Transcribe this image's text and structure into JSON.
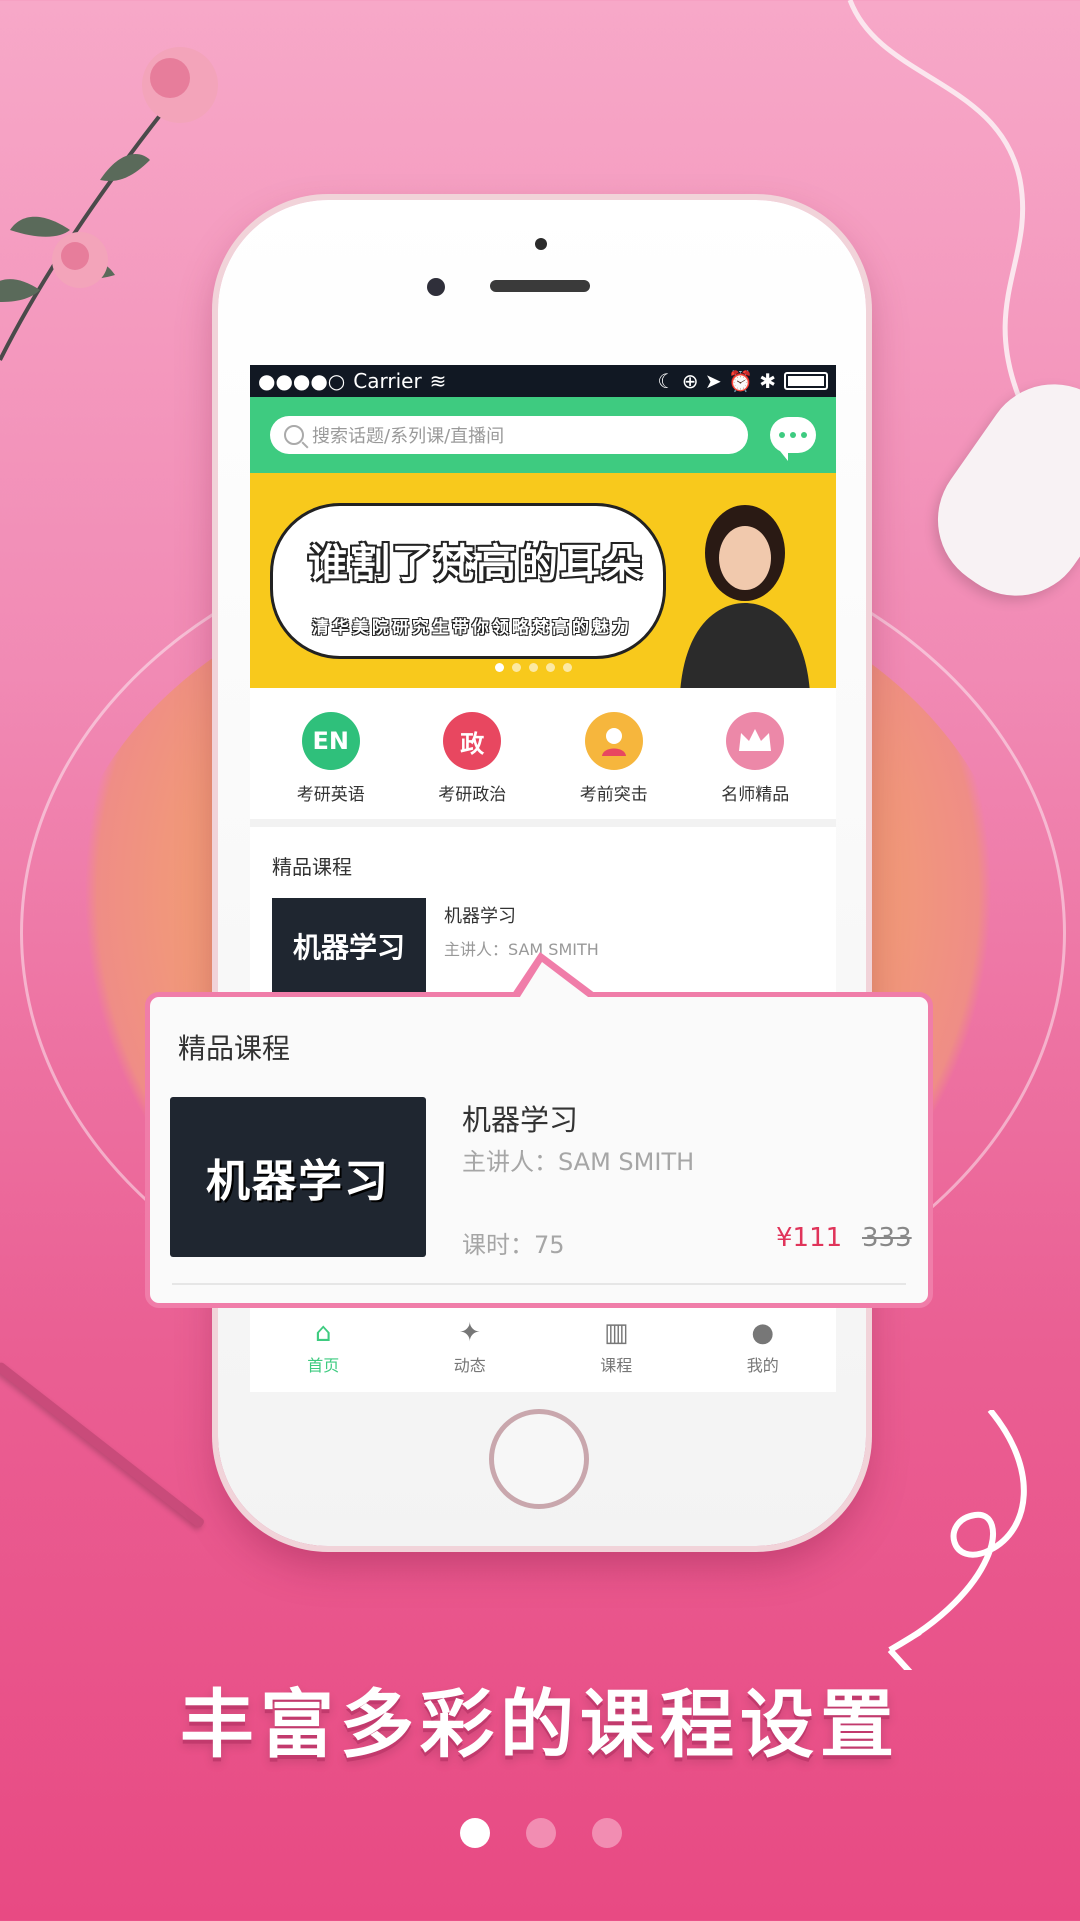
{
  "status_bar": {
    "signal": "●●●●○",
    "carrier": "Carrier",
    "wifi_icon": "wifi-icon",
    "status_icons": "☾ ⊕ ➤ ⏰ ✱"
  },
  "search": {
    "placeholder": "搜索话题/系列课/直播间",
    "icon": "search-icon",
    "message_icon": "chat-bubble-icon"
  },
  "banner": {
    "title": "谁割了梵高的耳朵",
    "subtitle": "清华美院研究生带你领略梵高的魅力",
    "dots_total": 5,
    "dots_active": 0
  },
  "categories": [
    {
      "label": "考研英语",
      "icon_text": "EN",
      "icon": "en-badge-icon",
      "color": "#2fc07b"
    },
    {
      "label": "考研政治",
      "icon_text": "政",
      "icon": "politics-badge-icon",
      "color": "#e84760"
    },
    {
      "label": "考前突击",
      "icon_text": "",
      "icon": "student-badge-icon",
      "color": "#f6b63d"
    },
    {
      "label": "名师精品",
      "icon_text": "",
      "icon": "crown-badge-icon",
      "color": "#ec88a8"
    }
  ],
  "featured": {
    "section_title": "精品课程",
    "course": {
      "thumb_text": "机器学习",
      "name": "机器学习",
      "teacher": "主讲人：SAM SMITH"
    }
  },
  "callout": {
    "section_title": "精品课程",
    "thumb_text": "机器学习",
    "name": "机器学习",
    "teacher": "主讲人：SAM SMITH",
    "hours": "课时：75",
    "price": "¥111",
    "old_price": "333"
  },
  "tabbar": {
    "items": [
      {
        "label": "首页",
        "icon": "home-icon",
        "active": true
      },
      {
        "label": "动态",
        "icon": "pinwheel-icon",
        "active": false
      },
      {
        "label": "课程",
        "icon": "books-icon",
        "active": false
      },
      {
        "label": "我的",
        "icon": "person-icon",
        "active": false
      }
    ]
  },
  "slogan": "丰富多彩的课程设置",
  "pager": {
    "total": 3,
    "active": 0
  },
  "colors": {
    "accent_green": "#3ecb80",
    "banner_yellow": "#f8c91c",
    "price_red": "#e0345a",
    "background_pink": "#ea5f93"
  }
}
